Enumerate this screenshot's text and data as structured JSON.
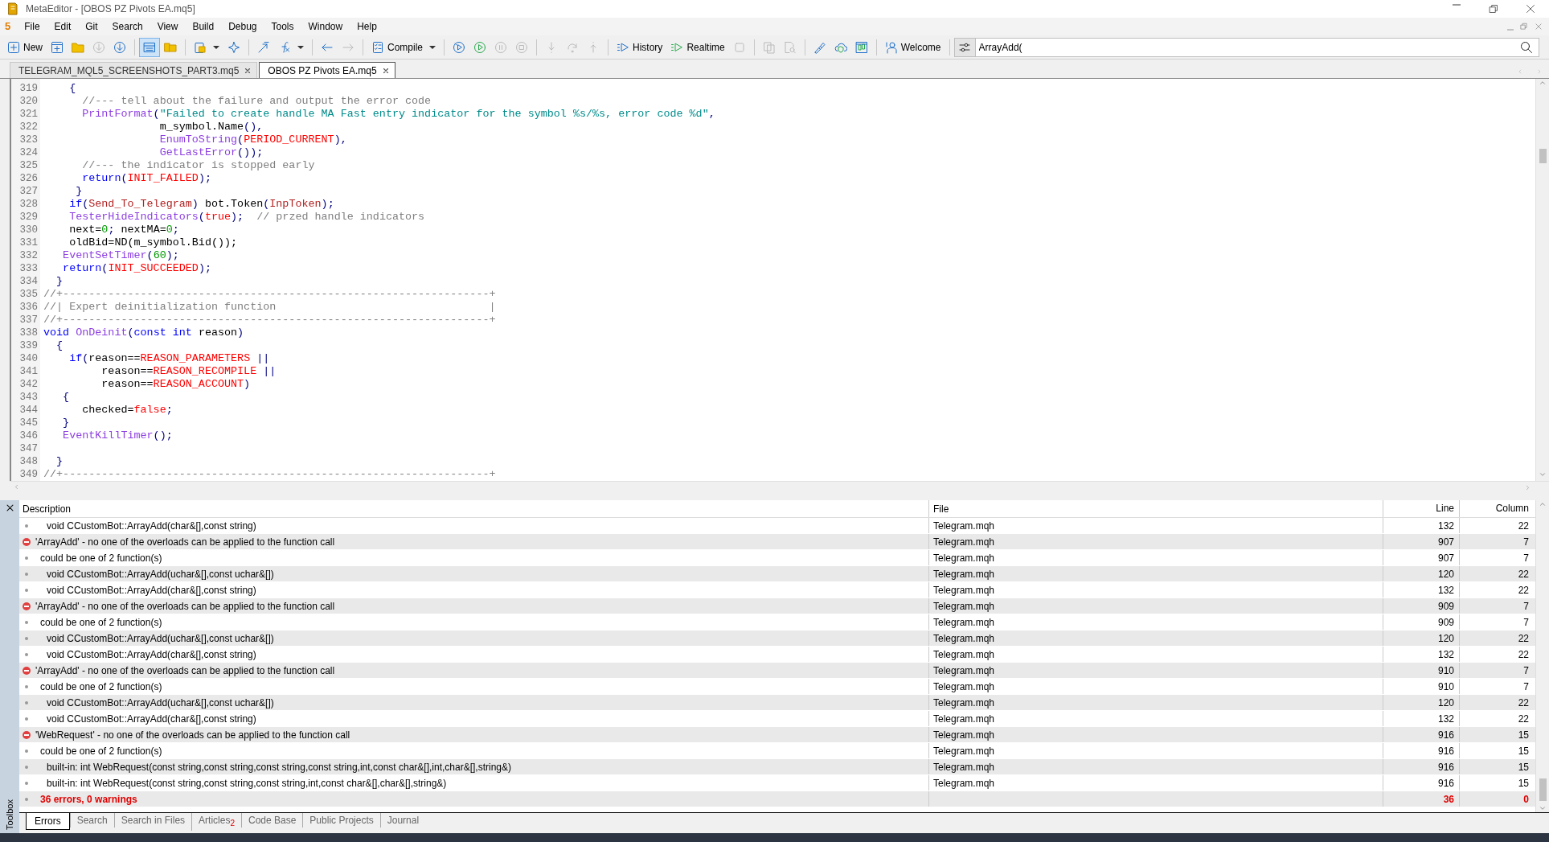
{
  "window": {
    "title": "MetaEditor - [OBOS PZ Pivots EA.mq5]"
  },
  "menu": {
    "logo": "5",
    "items": [
      "File",
      "Edit",
      "Git",
      "Search",
      "View",
      "Build",
      "Debug",
      "Tools",
      "Window",
      "Help"
    ]
  },
  "toolbar": {
    "groups": [
      [
        {
          "label": "New",
          "disabled": false,
          "pressed": false,
          "dropdown": false
        },
        {
          "disabled": false,
          "pressed": false,
          "dropdown": false
        },
        {
          "disabled": false,
          "pressed": false,
          "dropdown": false
        },
        {
          "disabled": true,
          "pressed": false,
          "dropdown": false
        },
        {
          "disabled": false,
          "pressed": false,
          "dropdown": false
        }
      ],
      [
        {
          "disabled": false,
          "pressed": true,
          "dropdown": false
        },
        {
          "disabled": false,
          "pressed": false,
          "dropdown": false
        }
      ],
      [
        {
          "disabled": false,
          "pressed": false,
          "dropdown": true
        },
        {
          "disabled": false,
          "pressed": false,
          "dropdown": false
        }
      ],
      [
        {
          "disabled": false,
          "pressed": false,
          "dropdown": false
        },
        {
          "disabled": false,
          "pressed": false,
          "dropdown": true
        }
      ],
      [
        {
          "disabled": false,
          "pressed": false,
          "dropdown": false
        },
        {
          "disabled": true,
          "pressed": false,
          "dropdown": false
        }
      ],
      [
        {
          "label": "Compile",
          "disabled": false,
          "pressed": false,
          "dropdown": true
        }
      ],
      [
        {
          "disabled": false,
          "pressed": false,
          "dropdown": false
        },
        {
          "disabled": false,
          "pressed": false,
          "dropdown": false
        },
        {
          "disabled": true,
          "pressed": false,
          "dropdown": false
        },
        {
          "disabled": true,
          "pressed": false,
          "dropdown": false
        }
      ],
      [
        {
          "disabled": true,
          "pressed": false,
          "dropdown": false
        },
        {
          "disabled": true,
          "pressed": false,
          "dropdown": false
        },
        {
          "disabled": true,
          "pressed": false,
          "dropdown": false
        }
      ],
      [
        {
          "label": "History",
          "disabled": false,
          "pressed": false,
          "dropdown": false
        },
        {
          "label": "Realtime",
          "disabled": false,
          "pressed": false,
          "dropdown": false
        },
        {
          "disabled": true,
          "pressed": false,
          "dropdown": false
        }
      ],
      [
        {
          "disabled": true,
          "pressed": false,
          "dropdown": false
        },
        {
          "disabled": true,
          "pressed": false,
          "dropdown": false
        }
      ],
      [
        {
          "disabled": false,
          "pressed": false,
          "dropdown": false
        },
        {
          "disabled": false,
          "pressed": false,
          "dropdown": false
        },
        {
          "disabled": false,
          "pressed": false,
          "dropdown": false
        }
      ],
      [
        {
          "label": "Welcome",
          "disabled": false,
          "pressed": false,
          "dropdown": false
        }
      ]
    ],
    "search": {
      "value": "ArrayAdd("
    }
  },
  "tabs": [
    {
      "label": "TELEGRAM_MQL5_SCREENSHOTS_PART3.mq5",
      "selected": false
    },
    {
      "label": "OBOS PZ Pivots EA.mq5",
      "selected": true
    }
  ],
  "editor": {
    "lines": [
      {
        "number": "319",
        "tokens": [
          {
            "kind": "op",
            "text": "    {"
          }
        ]
      },
      {
        "number": "320",
        "tokens": [
          {
            "kind": "cmt",
            "text": "      //--- tell about the failure and output the error code"
          }
        ]
      },
      {
        "number": "321",
        "tokens": [
          {
            "kind": "fn",
            "text": "      PrintFormat"
          },
          {
            "kind": "op",
            "text": "("
          },
          {
            "kind": "str",
            "text": "\"Failed to create handle MA Fast entry indicator for the symbol %s/%s, error code %d\""
          },
          {
            "kind": "op",
            "text": ","
          }
        ]
      },
      {
        "number": "322",
        "tokens": [
          {
            "kind": "plain",
            "text": "                  m_symbol.Name"
          },
          {
            "kind": "op",
            "text": "(),"
          }
        ]
      },
      {
        "number": "323",
        "tokens": [
          {
            "kind": "fn",
            "text": "                  EnumToString"
          },
          {
            "kind": "op",
            "text": "("
          },
          {
            "kind": "const",
            "text": "PERIOD_CURRENT"
          },
          {
            "kind": "op",
            "text": "),"
          }
        ]
      },
      {
        "number": "324",
        "tokens": [
          {
            "kind": "fn",
            "text": "                  GetLastError"
          },
          {
            "kind": "op",
            "text": "());"
          }
        ]
      },
      {
        "number": "325",
        "tokens": [
          {
            "kind": "cmt",
            "text": "      //--- the indicator is stopped early"
          }
        ]
      },
      {
        "number": "326",
        "tokens": [
          {
            "kind": "kw",
            "text": "      return"
          },
          {
            "kind": "op",
            "text": "("
          },
          {
            "kind": "const",
            "text": "INIT_FAILED"
          },
          {
            "kind": "op",
            "text": ");"
          }
        ]
      },
      {
        "number": "327",
        "tokens": [
          {
            "kind": "op",
            "text": "     }"
          }
        ]
      },
      {
        "number": "328",
        "tokens": [
          {
            "kind": "kw",
            "text": "    if"
          },
          {
            "kind": "op",
            "text": "("
          },
          {
            "kind": "input",
            "text": "Send_To_Telegram"
          },
          {
            "kind": "op",
            "text": ")"
          },
          {
            "kind": "plain",
            "text": " bot.Token"
          },
          {
            "kind": "op",
            "text": "("
          },
          {
            "kind": "input",
            "text": "InpToken"
          },
          {
            "kind": "op",
            "text": ");"
          }
        ]
      },
      {
        "number": "329",
        "tokens": [
          {
            "kind": "fn",
            "text": "    TesterHideIndicators"
          },
          {
            "kind": "op",
            "text": "("
          },
          {
            "kind": "const",
            "text": "true"
          },
          {
            "kind": "op",
            "text": ");  "
          },
          {
            "kind": "cmt",
            "text": "// przed handle indicators"
          }
        ]
      },
      {
        "number": "330",
        "tokens": [
          {
            "kind": "plain",
            "text": "    next="
          },
          {
            "kind": "num",
            "text": "0"
          },
          {
            "kind": "op",
            "text": ";"
          },
          {
            "kind": "plain",
            "text": " nextMA="
          },
          {
            "kind": "num",
            "text": "0"
          },
          {
            "kind": "op",
            "text": ";"
          }
        ]
      },
      {
        "number": "331",
        "tokens": [
          {
            "kind": "plain",
            "text": "    oldBid=ND(m_symbol.Bid());"
          }
        ]
      },
      {
        "number": "332",
        "tokens": [
          {
            "kind": "fn",
            "text": "   EventSetTimer"
          },
          {
            "kind": "op",
            "text": "("
          },
          {
            "kind": "num",
            "text": "60"
          },
          {
            "kind": "op",
            "text": ");"
          }
        ]
      },
      {
        "number": "333",
        "tokens": [
          {
            "kind": "kw",
            "text": "   return"
          },
          {
            "kind": "op",
            "text": "("
          },
          {
            "kind": "const",
            "text": "INIT_SUCCEEDED"
          },
          {
            "kind": "op",
            "text": ");"
          }
        ]
      },
      {
        "number": "334",
        "tokens": [
          {
            "kind": "op",
            "text": "  }"
          }
        ]
      },
      {
        "number": "335",
        "tokens": [
          {
            "kind": "cmt",
            "text": "//+------------------------------------------------------------------+"
          }
        ]
      },
      {
        "number": "336",
        "tokens": [
          {
            "kind": "cmt",
            "text": "//| Expert deinitialization function                                 |"
          }
        ]
      },
      {
        "number": "337",
        "tokens": [
          {
            "kind": "cmt",
            "text": "//+------------------------------------------------------------------+"
          }
        ]
      },
      {
        "number": "338",
        "tokens": [
          {
            "kind": "kw",
            "text": "void "
          },
          {
            "kind": "fn",
            "text": "OnDeinit"
          },
          {
            "kind": "op",
            "text": "("
          },
          {
            "kind": "kw",
            "text": "const int"
          },
          {
            "kind": "plain",
            "text": " reason"
          },
          {
            "kind": "op",
            "text": ")"
          }
        ]
      },
      {
        "number": "339",
        "tokens": [
          {
            "kind": "op",
            "text": "  {"
          }
        ]
      },
      {
        "number": "340",
        "tokens": [
          {
            "kind": "kw",
            "text": "    if"
          },
          {
            "kind": "op",
            "text": "("
          },
          {
            "kind": "plain",
            "text": "reason=="
          },
          {
            "kind": "const",
            "text": "REASON_PARAMETERS"
          },
          {
            "kind": "op",
            "text": " ||"
          }
        ]
      },
      {
        "number": "341",
        "tokens": [
          {
            "kind": "plain",
            "text": "         reason=="
          },
          {
            "kind": "const",
            "text": "REASON_RECOMPILE"
          },
          {
            "kind": "op",
            "text": " ||"
          }
        ]
      },
      {
        "number": "342",
        "tokens": [
          {
            "kind": "plain",
            "text": "         reason=="
          },
          {
            "kind": "const",
            "text": "REASON_ACCOUNT"
          },
          {
            "kind": "op",
            "text": ")"
          }
        ]
      },
      {
        "number": "343",
        "tokens": [
          {
            "kind": "op",
            "text": "   {"
          }
        ]
      },
      {
        "number": "344",
        "tokens": [
          {
            "kind": "plain",
            "text": "      checked="
          },
          {
            "kind": "const",
            "text": "false"
          },
          {
            "kind": "op",
            "text": ";"
          }
        ]
      },
      {
        "number": "345",
        "tokens": [
          {
            "kind": "op",
            "text": "   }"
          }
        ]
      },
      {
        "number": "346",
        "tokens": [
          {
            "kind": "fn",
            "text": "   EventKillTimer"
          },
          {
            "kind": "op",
            "text": "();"
          }
        ]
      },
      {
        "number": "347"
      },
      {
        "number": "348",
        "tokens": [
          {
            "kind": "op",
            "text": "  }"
          }
        ]
      },
      {
        "number": "349",
        "tokens": [
          {
            "kind": "cmt",
            "text": "//+------------------------------------------------------------------+"
          }
        ]
      }
    ]
  },
  "errors": {
    "columns": [
      "Description",
      "File",
      "Line",
      "Column"
    ],
    "rows": [
      {
        "kind": "candidate",
        "description": "void CCustomBot::ArrayAdd(char&[],const string)",
        "file": "Telegram.mqh",
        "line": "132",
        "column": "22"
      },
      {
        "kind": "error",
        "description": "'ArrayAdd' - no one of the overloads can be applied to the function call",
        "file": "Telegram.mqh",
        "line": "907",
        "column": "7"
      },
      {
        "kind": "note",
        "description": "could be one of 2 function(s)",
        "file": "Telegram.mqh",
        "line": "907",
        "column": "7"
      },
      {
        "kind": "candidate",
        "description": "void CCustomBot::ArrayAdd(uchar&[],const uchar&[])",
        "file": "Telegram.mqh",
        "line": "120",
        "column": "22"
      },
      {
        "kind": "candidate",
        "description": "void CCustomBot::ArrayAdd(char&[],const string)",
        "file": "Telegram.mqh",
        "line": "132",
        "column": "22"
      },
      {
        "kind": "error",
        "description": "'ArrayAdd' - no one of the overloads can be applied to the function call",
        "file": "Telegram.mqh",
        "line": "909",
        "column": "7"
      },
      {
        "kind": "note",
        "description": "could be one of 2 function(s)",
        "file": "Telegram.mqh",
        "line": "909",
        "column": "7"
      },
      {
        "kind": "candidate",
        "description": "void CCustomBot::ArrayAdd(uchar&[],const uchar&[])",
        "file": "Telegram.mqh",
        "line": "120",
        "column": "22"
      },
      {
        "kind": "candidate",
        "description": "void CCustomBot::ArrayAdd(char&[],const string)",
        "file": "Telegram.mqh",
        "line": "132",
        "column": "22"
      },
      {
        "kind": "error",
        "description": "'ArrayAdd' - no one of the overloads can be applied to the function call",
        "file": "Telegram.mqh",
        "line": "910",
        "column": "7"
      },
      {
        "kind": "note",
        "description": "could be one of 2 function(s)",
        "file": "Telegram.mqh",
        "line": "910",
        "column": "7"
      },
      {
        "kind": "candidate",
        "description": "void CCustomBot::ArrayAdd(uchar&[],const uchar&[])",
        "file": "Telegram.mqh",
        "line": "120",
        "column": "22"
      },
      {
        "kind": "candidate",
        "description": "void CCustomBot::ArrayAdd(char&[],const string)",
        "file": "Telegram.mqh",
        "line": "132",
        "column": "22"
      },
      {
        "kind": "error",
        "description": "'WebRequest' - no one of the overloads can be applied to the function call",
        "file": "Telegram.mqh",
        "line": "916",
        "column": "15"
      },
      {
        "kind": "note",
        "description": "could be one of 2 function(s)",
        "file": "Telegram.mqh",
        "line": "916",
        "column": "15"
      },
      {
        "kind": "candidate",
        "description": "built-in: int WebRequest(const string,const string,const string,const string,int,const char&[],int,char&[],string&)",
        "file": "Telegram.mqh",
        "line": "916",
        "column": "15"
      },
      {
        "kind": "candidate",
        "description": "built-in: int WebRequest(const string,const string,const string,int,const char&[],char&[],string&)",
        "file": "Telegram.mqh",
        "line": "916",
        "column": "15"
      },
      {
        "kind": "summary",
        "description": "36 errors, 0 warnings",
        "line": "36",
        "column": "0"
      }
    ]
  },
  "toolbox": {
    "label": "Toolbox",
    "tabs": [
      {
        "label": "Errors",
        "selected": true
      },
      {
        "label": "Search",
        "selected": false
      },
      {
        "label": "Search in Files",
        "selected": false
      },
      {
        "label": "Articles",
        "badge": "2",
        "selected": false
      },
      {
        "label": "Code Base",
        "selected": false
      },
      {
        "label": "Public Projects",
        "selected": false
      },
      {
        "label": "Journal",
        "selected": false
      }
    ]
  }
}
